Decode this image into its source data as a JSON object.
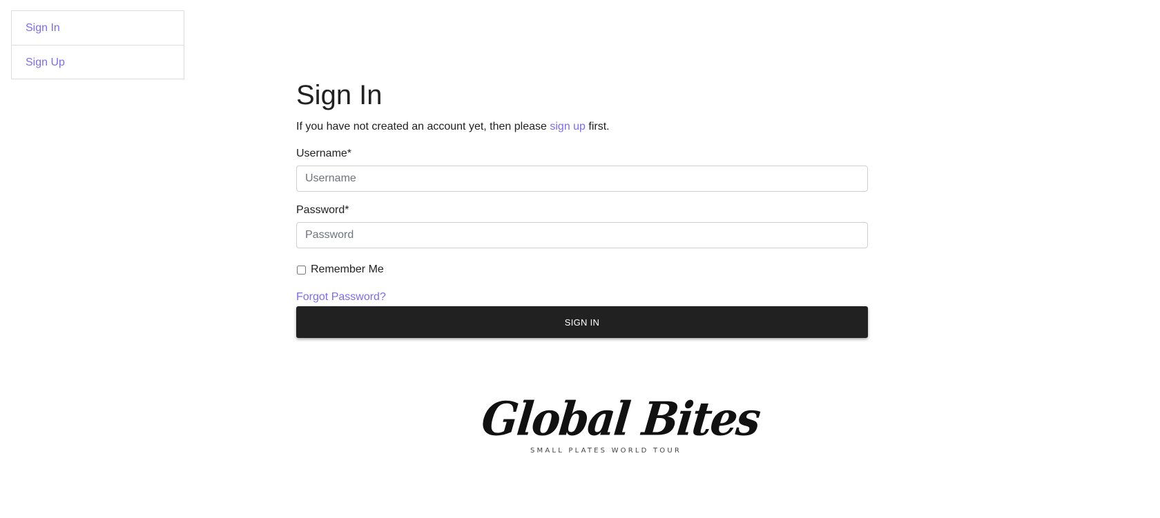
{
  "sidebar": {
    "items": [
      {
        "label": "Sign In"
      },
      {
        "label": "Sign Up"
      }
    ]
  },
  "form": {
    "title": "Sign In",
    "lead_prefix": "If you have not created an account yet, then please ",
    "lead_link": "sign up",
    "lead_suffix": " first.",
    "username": {
      "label": "Username*",
      "placeholder": "Username",
      "value": ""
    },
    "password": {
      "label": "Password*",
      "placeholder": "Password",
      "value": ""
    },
    "remember_label": "Remember Me",
    "forgot_label": "Forgot Password?",
    "submit_label": "SIGN IN"
  },
  "logo": {
    "name": "Global Bites",
    "tagline": "SMALL PLATES WORLD TOUR"
  },
  "colors": {
    "link": "#7b6cf6",
    "button_bg": "#212121",
    "button_text": "#ffffff",
    "border": "#dcdcdc"
  }
}
